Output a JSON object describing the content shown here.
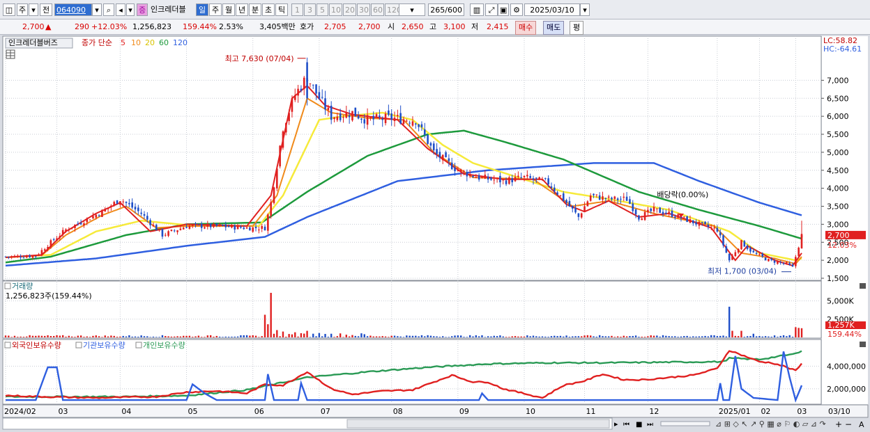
{
  "toolbar": {
    "type_label": "주",
    "prefix_label": "전",
    "code": "064090",
    "stock_name_badge": "증",
    "stock_name": "인크레더블",
    "periods": [
      "일",
      "주",
      "월",
      "년",
      "분",
      "초",
      "틱"
    ],
    "active_period": "일",
    "intervals": [
      "1",
      "3",
      "5",
      "10",
      "20",
      "30",
      "60",
      "120"
    ],
    "count": "265",
    "count_total": "/600",
    "date": "2025/03/10"
  },
  "quote": {
    "price": "2,700",
    "arrow": "▲",
    "change": "290",
    "change_pct": "+12.03%",
    "volume": "1,256,823",
    "volume_ratio": "159.44%",
    "turnover": "2.53%",
    "amount": "3,405백만",
    "ask_label": "호가",
    "ask": "2,705",
    "bid": "2,700",
    "open_label": "시",
    "open": "2,650",
    "high_label": "고",
    "high": "3,100",
    "low_label": "저",
    "low": "2,415",
    "buy_label": "매수",
    "sell_label": "매도",
    "eq_label": "평"
  },
  "colors": {
    "candle_up": "#e02020",
    "candle_down": "#1f4fc8",
    "ma5": "#e02020",
    "ma10": "#f08a1a",
    "ma20": "#f6ea3a",
    "ma60": "#1d9a3c",
    "ma120": "#2f5fe0",
    "foreign": "#e02020",
    "institution": "#2f5fe0",
    "individual": "#2a9a55"
  },
  "chart_data": [
    {
      "type": "candlestick",
      "title": "인크레더블버즈",
      "legend": {
        "label": "종가 단순",
        "periods": [
          "5",
          "10",
          "20",
          "60",
          "120"
        ],
        "colors": [
          "#e02020",
          "#f08a1a",
          "#f6ea3a",
          "#1d9a3c",
          "#2f5fe0"
        ]
      },
      "ylim": [
        1500,
        7800
      ],
      "yticks": [
        "7,000",
        "6,500",
        "6,000",
        "5,500",
        "5,000",
        "4,500",
        "4,000",
        "3,500",
        "3,000",
        "2,500",
        "2,000",
        "1,500"
      ],
      "ytick_values": [
        7000,
        6500,
        6000,
        5500,
        5000,
        4500,
        4000,
        3500,
        3000,
        2500,
        2000,
        1500
      ],
      "x_labels": [
        "2024/02",
        "03",
        "04",
        "05",
        "06",
        "07",
        "08",
        "09",
        "10",
        "11",
        "12",
        "2025/01",
        "02",
        "03",
        "03/10"
      ],
      "lc_label": "LC:58.82",
      "hc_label": "HC:-64.61",
      "current_price_label": "2,700",
      "current_change_label": "12.03%",
      "annotations": {
        "high": "최고 7,630 (07/04)",
        "low": "최저 1,700 (03/04)",
        "dividend": "배당락(0.00%)"
      },
      "close_anchors": [
        [
          0,
          2100
        ],
        [
          10,
          2120
        ],
        [
          15,
          2500
        ],
        [
          20,
          2850
        ],
        [
          32,
          3350
        ],
        [
          38,
          3700
        ],
        [
          45,
          3300
        ],
        [
          52,
          2700
        ],
        [
          60,
          2950
        ],
        [
          70,
          2950
        ],
        [
          80,
          2900
        ],
        [
          86,
          2900
        ],
        [
          88,
          3600
        ],
        [
          92,
          5700
        ],
        [
          96,
          6600
        ],
        [
          100,
          7100
        ],
        [
          104,
          6500
        ],
        [
          108,
          6000
        ],
        [
          115,
          6100
        ],
        [
          120,
          5900
        ],
        [
          128,
          5950
        ],
        [
          136,
          5900
        ],
        [
          142,
          5000
        ],
        [
          150,
          4500
        ],
        [
          157,
          4300
        ],
        [
          165,
          4200
        ],
        [
          172,
          4300
        ],
        [
          180,
          4150
        ],
        [
          186,
          3600
        ],
        [
          190,
          3200
        ],
        [
          194,
          3800
        ],
        [
          200,
          3700
        ],
        [
          206,
          3700
        ],
        [
          210,
          3200
        ],
        [
          215,
          3400
        ],
        [
          220,
          3300
        ],
        [
          230,
          3000
        ],
        [
          236,
          2850
        ],
        [
          240,
          2000
        ],
        [
          244,
          2500
        ],
        [
          248,
          2200
        ],
        [
          253,
          2000
        ],
        [
          259,
          1900
        ],
        [
          261,
          1800
        ],
        [
          264,
          2700
        ]
      ],
      "ma_anchors": {
        "5": [
          [
            0,
            2080
          ],
          [
            12,
            2150
          ],
          [
            20,
            2800
          ],
          [
            30,
            3300
          ],
          [
            38,
            3600
          ],
          [
            48,
            2800
          ],
          [
            60,
            3000
          ],
          [
            80,
            2950
          ],
          [
            88,
            3800
          ],
          [
            95,
            6500
          ],
          [
            100,
            6850
          ],
          [
            106,
            6300
          ],
          [
            115,
            6050
          ],
          [
            130,
            5900
          ],
          [
            140,
            5100
          ],
          [
            152,
            4400
          ],
          [
            165,
            4250
          ],
          [
            178,
            4250
          ],
          [
            186,
            3550
          ],
          [
            192,
            3350
          ],
          [
            200,
            3650
          ],
          [
            210,
            3200
          ],
          [
            220,
            3300
          ],
          [
            234,
            2900
          ],
          [
            242,
            2000
          ],
          [
            246,
            2400
          ],
          [
            255,
            2000
          ],
          [
            261,
            1850
          ],
          [
            264,
            2200
          ]
        ],
        "10": [
          [
            0,
            2080
          ],
          [
            12,
            2140
          ],
          [
            20,
            2700
          ],
          [
            32,
            3250
          ],
          [
            40,
            3500
          ],
          [
            50,
            2900
          ],
          [
            60,
            2950
          ],
          [
            82,
            2950
          ],
          [
            90,
            3800
          ],
          [
            100,
            6500
          ],
          [
            108,
            6100
          ],
          [
            120,
            5950
          ],
          [
            132,
            5900
          ],
          [
            142,
            5000
          ],
          [
            155,
            4300
          ],
          [
            175,
            4250
          ],
          [
            188,
            3500
          ],
          [
            200,
            3650
          ],
          [
            215,
            3300
          ],
          [
            235,
            2950
          ],
          [
            244,
            2200
          ],
          [
            255,
            2050
          ],
          [
            262,
            1900
          ],
          [
            264,
            2100
          ]
        ],
        "20": [
          [
            0,
            2080
          ],
          [
            15,
            2150
          ],
          [
            30,
            2800
          ],
          [
            45,
            3100
          ],
          [
            60,
            2980
          ],
          [
            84,
            2950
          ],
          [
            92,
            3800
          ],
          [
            104,
            5900
          ],
          [
            112,
            6000
          ],
          [
            125,
            6100
          ],
          [
            135,
            5900
          ],
          [
            145,
            5200
          ],
          [
            155,
            4700
          ],
          [
            170,
            4300
          ],
          [
            185,
            3900
          ],
          [
            200,
            3700
          ],
          [
            220,
            3400
          ],
          [
            240,
            2800
          ],
          [
            250,
            2200
          ],
          [
            262,
            2000
          ],
          [
            264,
            2050
          ]
        ],
        "60": [
          [
            0,
            1940
          ],
          [
            15,
            2100
          ],
          [
            40,
            2700
          ],
          [
            60,
            3000
          ],
          [
            85,
            3050
          ],
          [
            100,
            3900
          ],
          [
            120,
            4900
          ],
          [
            140,
            5500
          ],
          [
            152,
            5600
          ],
          [
            165,
            5300
          ],
          [
            185,
            4800
          ],
          [
            210,
            3900
          ],
          [
            230,
            3400
          ],
          [
            250,
            2950
          ],
          [
            264,
            2600
          ]
        ],
        "120": [
          [
            0,
            1850
          ],
          [
            30,
            2050
          ],
          [
            60,
            2400
          ],
          [
            86,
            2650
          ],
          [
            100,
            3200
          ],
          [
            130,
            4200
          ],
          [
            160,
            4500
          ],
          [
            195,
            4700
          ],
          [
            215,
            4700
          ],
          [
            230,
            4200
          ],
          [
            250,
            3600
          ],
          [
            264,
            3250
          ]
        ]
      }
    },
    {
      "type": "bar",
      "title": "거래량",
      "subtitle": "1,256,823주(159.44%)",
      "yticks": [
        "5,000K",
        "2,500K"
      ],
      "ytick_values": [
        5000,
        2500
      ],
      "ylim": [
        0,
        6000
      ],
      "current_label": "1,257K",
      "current_ratio_label": "159.44%",
      "spikes": [
        [
          86,
          3100
        ],
        [
          87,
          1800
        ],
        [
          88,
          6100
        ],
        [
          90,
          1000
        ],
        [
          92,
          800
        ],
        [
          96,
          700
        ],
        [
          100,
          900
        ],
        [
          104,
          600
        ],
        [
          108,
          500
        ],
        [
          140,
          300
        ],
        [
          240,
          4200
        ],
        [
          241,
          900
        ],
        [
          244,
          900
        ],
        [
          248,
          500
        ],
        [
          262,
          1400
        ],
        [
          263,
          1300
        ],
        [
          264,
          1257
        ]
      ],
      "base_level": 180
    },
    {
      "type": "line",
      "series_names": [
        "외국인보유수량",
        "기관보유수량",
        "개인보유수량"
      ],
      "yticks": [
        "4,000,000",
        "2,000,000"
      ],
      "ytick_values": [
        4000000,
        2000000
      ],
      "ylim": [
        700000,
        5500000
      ],
      "foreign_anchors": [
        [
          0,
          1400000
        ],
        [
          12,
          1300000
        ],
        [
          20,
          1250000
        ],
        [
          30,
          1200000
        ],
        [
          50,
          1300000
        ],
        [
          60,
          1700000
        ],
        [
          70,
          1800000
        ],
        [
          80,
          1600000
        ],
        [
          86,
          2400000
        ],
        [
          92,
          2300000
        ],
        [
          100,
          3500000
        ],
        [
          108,
          2000000
        ],
        [
          115,
          1500000
        ],
        [
          125,
          1800000
        ],
        [
          135,
          1900000
        ],
        [
          142,
          2600000
        ],
        [
          148,
          3200000
        ],
        [
          155,
          2600000
        ],
        [
          160,
          2600000
        ],
        [
          165,
          2000000
        ],
        [
          170,
          1700000
        ],
        [
          178,
          1200000
        ],
        [
          185,
          2300000
        ],
        [
          192,
          2700000
        ],
        [
          198,
          3300000
        ],
        [
          205,
          2800000
        ],
        [
          212,
          2800000
        ],
        [
          220,
          3000000
        ],
        [
          228,
          3200000
        ],
        [
          236,
          3800000
        ],
        [
          240,
          5400000
        ],
        [
          246,
          4800000
        ],
        [
          250,
          4400000
        ],
        [
          254,
          4300000
        ],
        [
          258,
          4000000
        ],
        [
          262,
          3600000
        ],
        [
          264,
          4200000
        ]
      ],
      "institution_anchors": [
        [
          0,
          1000000
        ],
        [
          10,
          1000000
        ],
        [
          14,
          3900000
        ],
        [
          17,
          3900000
        ],
        [
          19,
          1000000
        ],
        [
          60,
          1000000
        ],
        [
          62,
          2400000
        ],
        [
          66,
          1600000
        ],
        [
          70,
          1000000
        ],
        [
          86,
          1000000
        ],
        [
          87,
          3300000
        ],
        [
          89,
          1000000
        ],
        [
          97,
          1000000
        ],
        [
          98,
          2500000
        ],
        [
          100,
          1000000
        ],
        [
          157,
          1000000
        ],
        [
          158,
          1600000
        ],
        [
          160,
          1000000
        ],
        [
          236,
          1000000
        ],
        [
          237,
          2500000
        ],
        [
          238,
          1000000
        ],
        [
          240,
          1000000
        ],
        [
          242,
          4900000
        ],
        [
          244,
          2000000
        ],
        [
          248,
          1200000
        ],
        [
          256,
          1000000
        ],
        [
          258,
          5300000
        ],
        [
          260,
          3000000
        ],
        [
          262,
          1000000
        ],
        [
          264,
          2300000
        ]
      ],
      "individual_anchors": [
        [
          0,
          1300000
        ],
        [
          40,
          1300000
        ],
        [
          60,
          1400000
        ],
        [
          80,
          1900000
        ],
        [
          100,
          3000000
        ],
        [
          120,
          3500000
        ],
        [
          140,
          3900000
        ],
        [
          160,
          4200000
        ],
        [
          180,
          4300000
        ],
        [
          200,
          4300000
        ],
        [
          238,
          4400000
        ],
        [
          240,
          4700000
        ],
        [
          250,
          4600000
        ],
        [
          262,
          5100000
        ],
        [
          264,
          5400000
        ]
      ]
    }
  ]
}
